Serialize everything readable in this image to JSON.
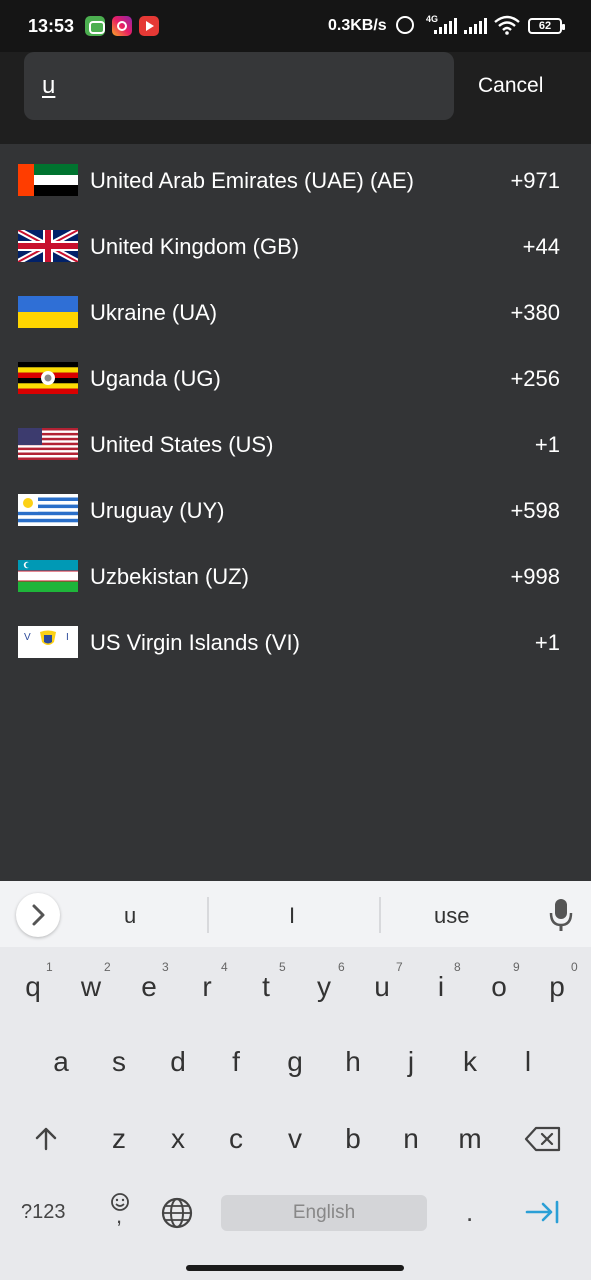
{
  "status_bar": {
    "time": "13:53",
    "net_speed": "0.3KB/s",
    "network_type": "4G",
    "battery": "62",
    "icons": [
      "message-app-icon",
      "instagram-icon",
      "youtube-icon",
      "alarm-icon",
      "signal-icon",
      "signal-icon",
      "wifi-icon",
      "battery-icon"
    ]
  },
  "search": {
    "query": "u",
    "cancel_label": "Cancel"
  },
  "countries": [
    {
      "name": "United Arab Emirates (UAE) (AE)",
      "code": "+971",
      "flag": "ae-flag-icon"
    },
    {
      "name": "United Kingdom (GB)",
      "code": "+44",
      "flag": "gb-flag-icon"
    },
    {
      "name": "Ukraine (UA)",
      "code": "+380",
      "flag": "ua-flag-icon"
    },
    {
      "name": "Uganda (UG)",
      "code": "+256",
      "flag": "ug-flag-icon"
    },
    {
      "name": "United States (US)",
      "code": "+1",
      "flag": "us-flag-icon"
    },
    {
      "name": "Uruguay (UY)",
      "code": "+598",
      "flag": "uy-flag-icon"
    },
    {
      "name": "Uzbekistan (UZ)",
      "code": "+998",
      "flag": "uz-flag-icon"
    },
    {
      "name": "US Virgin Islands (VI)",
      "code": "+1",
      "flag": "vi-flag-icon"
    }
  ],
  "keyboard": {
    "suggestions": [
      "u",
      "I",
      "use"
    ],
    "row1": [
      "q",
      "w",
      "e",
      "r",
      "t",
      "y",
      "u",
      "i",
      "o",
      "p"
    ],
    "row1_nums": [
      "1",
      "2",
      "3",
      "4",
      "5",
      "6",
      "7",
      "8",
      "9",
      "0"
    ],
    "row2": [
      "a",
      "s",
      "d",
      "f",
      "g",
      "h",
      "j",
      "k",
      "l"
    ],
    "row3": [
      "z",
      "x",
      "c",
      "v",
      "b",
      "n",
      "m"
    ],
    "symbols_label": "?123",
    "comma_label": ",",
    "period_label": ".",
    "space_label": "English",
    "accent_color": "#2a9fd6"
  },
  "colors": {
    "list_bg": "#333436",
    "header_bg": "#1f1f1f",
    "search_box_bg": "#363739",
    "keyboard_bg": "#e8e9ec"
  }
}
